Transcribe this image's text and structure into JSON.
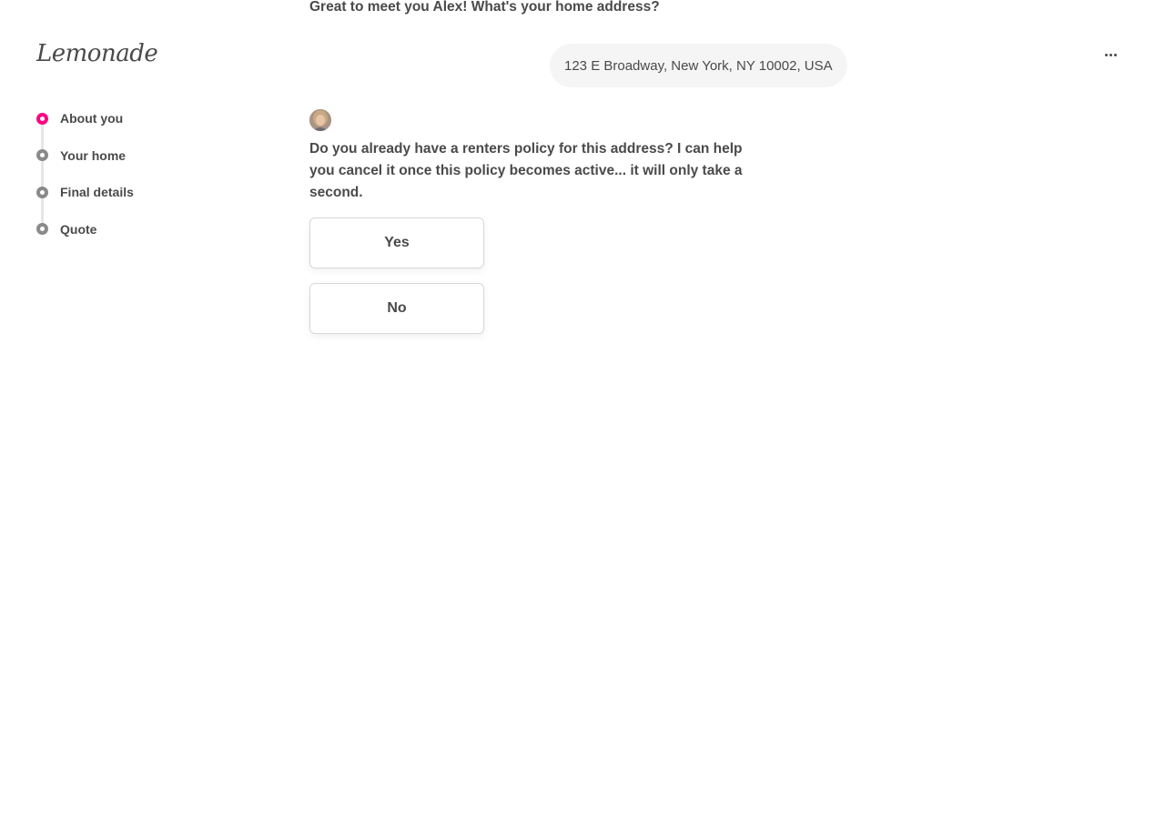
{
  "brand": {
    "logo_text": "Lemonade",
    "accent_color": "#ff0083"
  },
  "steps": [
    {
      "label": "About you",
      "active": true
    },
    {
      "label": "Your home",
      "active": false
    },
    {
      "label": "Final details",
      "active": false
    },
    {
      "label": "Quote",
      "active": false
    }
  ],
  "chat": {
    "previous_question": "Great to meet you Alex! What's your home address?",
    "user_answer": "123 E Broadway, New York, NY 10002, USA",
    "bot_avatar_icon": "bot-avatar",
    "question": "Do you already have a renters policy for this address? I can help you cancel it once this policy becomes active... it will only take a second.",
    "options": [
      {
        "label": "Yes"
      },
      {
        "label": "No"
      }
    ]
  },
  "header": {
    "more_icon": "more-horizontal-icon"
  }
}
